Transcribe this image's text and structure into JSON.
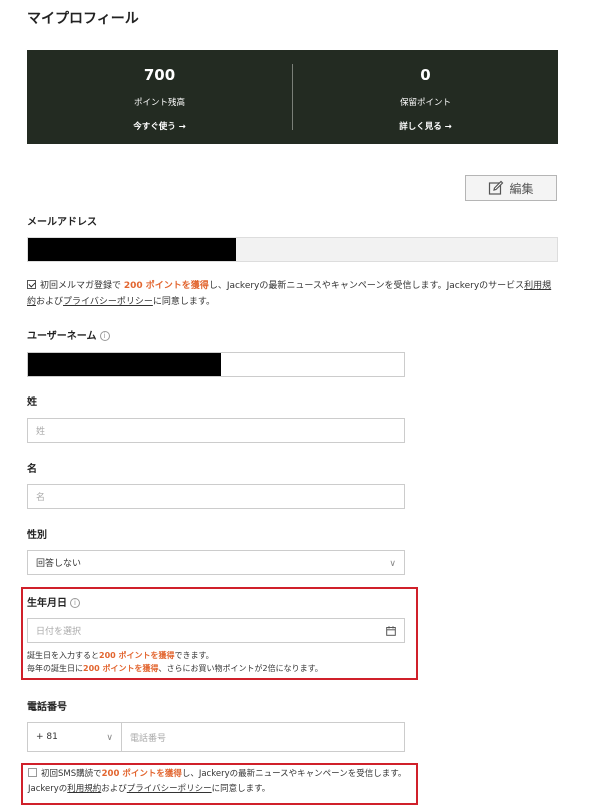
{
  "page": {
    "title": "マイプロフィール"
  },
  "points": {
    "available": {
      "value": "700",
      "label": "ポイント残高",
      "link": "今すぐ使う →"
    },
    "pending": {
      "value": "0",
      "label": "保留ポイント",
      "link": "詳しく見る →"
    }
  },
  "edit_button": {
    "label": "編集",
    "icon": "edit-icon"
  },
  "email": {
    "label": "メールアドレス",
    "value": ""
  },
  "newsletter": {
    "checked": true,
    "text_before": "初回メルマガ登録で",
    "highlight": "200 ポイントを獲得",
    "text_after": "し、Jackeryの最新ニュースやキャンペーンを受信します。Jackeryのサービス",
    "terms": "利用規約",
    "and": "および",
    "privacy": "プライバシーポリシー",
    "agree": "に同意します。"
  },
  "username": {
    "label": "ユーザーネーム",
    "value": ""
  },
  "last_name": {
    "label": "姓",
    "placeholder": "姓"
  },
  "first_name": {
    "label": "名",
    "placeholder": "名"
  },
  "gender": {
    "label": "性別",
    "selected": "回答しない"
  },
  "birthday": {
    "label": "生年月日",
    "placeholder": "日付を選択",
    "hint1_before": "誕生日を入力すると",
    "hint1_highlight": "200 ポイントを獲得",
    "hint1_after": "できます。",
    "hint2_before": "毎年の誕生日に",
    "hint2_highlight": "200 ポイントを獲得",
    "hint2_after": "、さらにお買い物ポイントが2倍になります。"
  },
  "phone": {
    "label": "電話番号",
    "country_code": "+ 81",
    "placeholder": "電話番号"
  },
  "sms": {
    "checked": false,
    "text_before": "初回SMS購読で",
    "highlight": "200 ポイントを獲得",
    "text_after": "し、Jackeryの最新ニュースやキャンペーンを受信します。Jackeryの",
    "terms": "利用規約",
    "and": "および",
    "privacy": "プライバシーポリシー",
    "agree": "に同意します。"
  },
  "colors": {
    "dark_panel": "#232b22",
    "accent": "#e2652f",
    "highlight_border": "#d0202a"
  }
}
